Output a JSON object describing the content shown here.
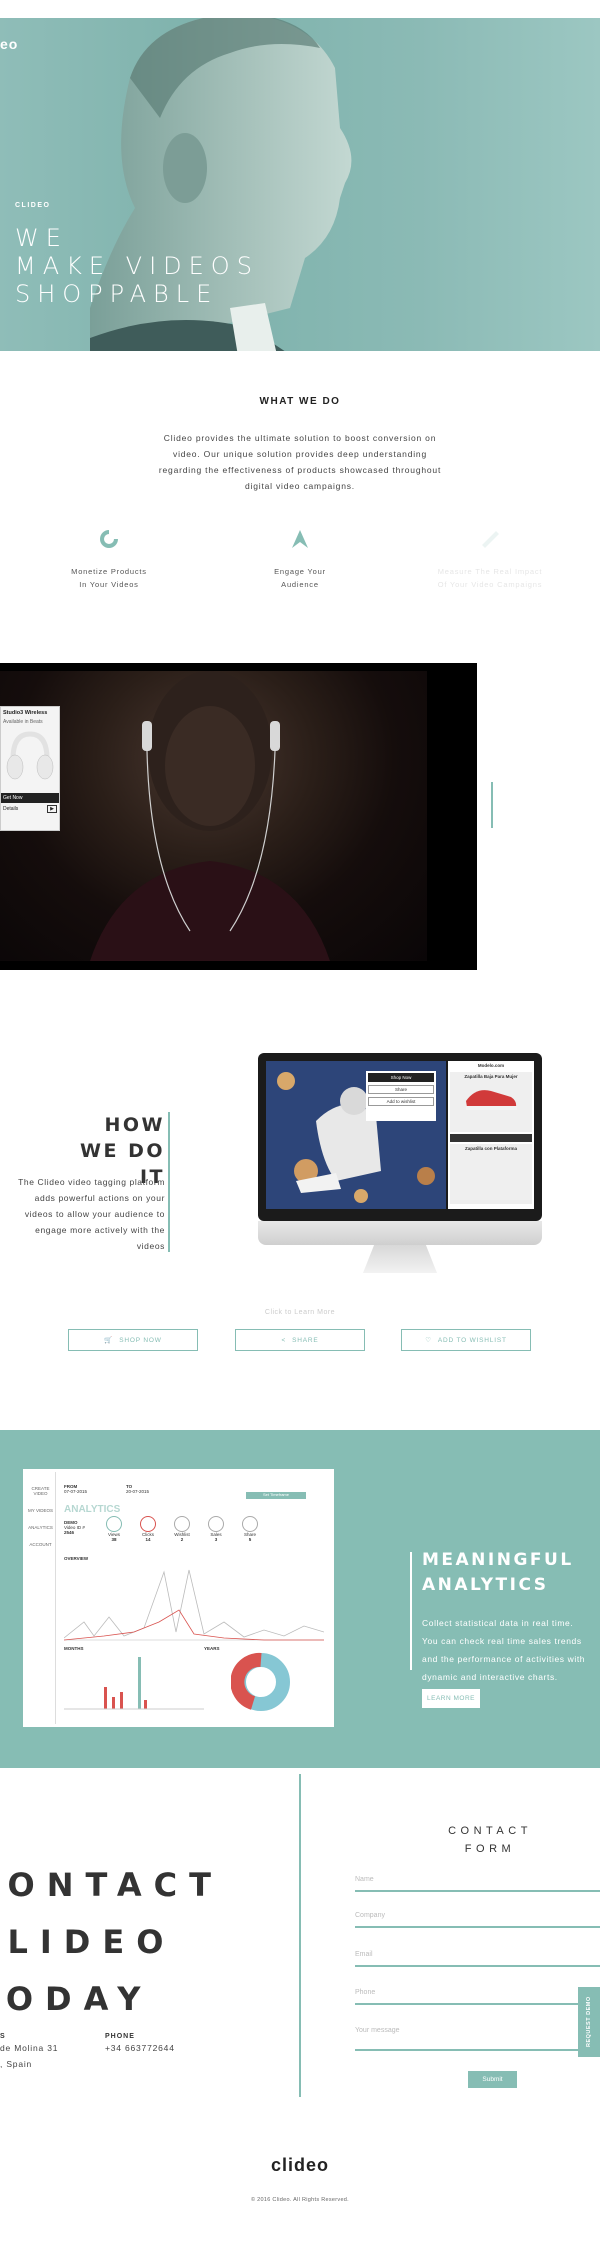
{
  "hero": {
    "logo": "eo",
    "small_label": "CLIDEO",
    "title_lines": [
      "WE",
      "MAKE VIDEOS",
      "SHOPPABLE"
    ]
  },
  "what_we_do": {
    "title": "WHAT WE DO",
    "text": "Clideo provides the ultimate solution to boost conversion on video. Our unique solution provides deep understanding regarding the effectiveness of products showcased throughout digital video campaigns.",
    "features": [
      {
        "line1": "Monetize Products",
        "line2": "In Your Videos",
        "icon": "pie-chart-icon"
      },
      {
        "line1": "Engage Your",
        "line2": "Audience",
        "icon": "arrow-up-icon"
      },
      {
        "line1": "Measure The Real Impact",
        "line2": "Of Your Video Campaigns",
        "icon": "measure-icon"
      }
    ]
  },
  "video": {
    "card_title": "Studio3 Wireless",
    "card_sub": "Available in Beats",
    "card_price": "Get Now",
    "card_btn": "Details"
  },
  "how": {
    "title_lines": [
      "HOW",
      "WE DO IT"
    ],
    "text": "The Clideo video tagging platform adds powerful actions on your videos to allow your audience to engage more actively with the videos",
    "monitor": {
      "site": "Modelo.com",
      "product1": "Zapatilla Baja Para Mujer",
      "product2": "Zapatilla con Plataforma",
      "popup_title": "Shop Now",
      "popup_items": [
        "Share",
        "Add to wishlist"
      ]
    },
    "click_learn": "Click to Learn More",
    "buttons": [
      {
        "label": "SHOP NOW",
        "icon": "cart-icon"
      },
      {
        "label": "SHARE",
        "icon": "share-icon"
      },
      {
        "label": "ADD TO WISHLIST",
        "icon": "heart-icon"
      }
    ]
  },
  "analytics": {
    "title_lines": [
      "MEANINGFUL",
      "ANALYTICS"
    ],
    "text": "Collect statistical data in real time. You can check real time sales trends and the performance of activities with dynamic and interactive charts.",
    "button": "LEARN MORE",
    "dash": {
      "sidebar": [
        "CREATE VIDEO",
        "MY VIDEOS",
        "ANALYTICS",
        "ACCOUNT"
      ],
      "from_label": "FROM",
      "from_value": "07-07-2015",
      "to_label": "TO",
      "to_value": "20-07-2015",
      "search_btn": "Set Timeframe",
      "heading": "ANALYTICS",
      "demo_label": "DEMO",
      "demo_sub": "Video ID #",
      "demo_num": "2546",
      "stats": [
        {
          "label": "Views",
          "value": "38"
        },
        {
          "label": "Clicks",
          "value": "14"
        },
        {
          "label": "Wishlist",
          "value": "2"
        },
        {
          "label": "Sales",
          "value": "3"
        },
        {
          "label": "Share",
          "value": "5"
        }
      ],
      "overview": "OVERVIEW",
      "months": "MONTHS",
      "years": "YEARS"
    }
  },
  "contact": {
    "big_lines": [
      "CONTACT",
      "CLIDEO",
      "TODAY"
    ],
    "address_label": "S",
    "address_lines": [
      "de Molina 31",
      ", Spain"
    ],
    "phone_label": "PHONE",
    "phone_value": "+34 663772644",
    "form_title_lines": [
      "CONTACT",
      "FORM"
    ],
    "fields": [
      "Name",
      "Company",
      "Email",
      "Phone",
      "Your message"
    ],
    "submit": "Submit",
    "request_demo": "REQUEST DEMO"
  },
  "footer": {
    "logo": "clideo",
    "copyright": "© 2016 Clideo. All Rights Reserved."
  },
  "colors": {
    "accent": "#86bdb4",
    "dark_text": "#333333"
  }
}
